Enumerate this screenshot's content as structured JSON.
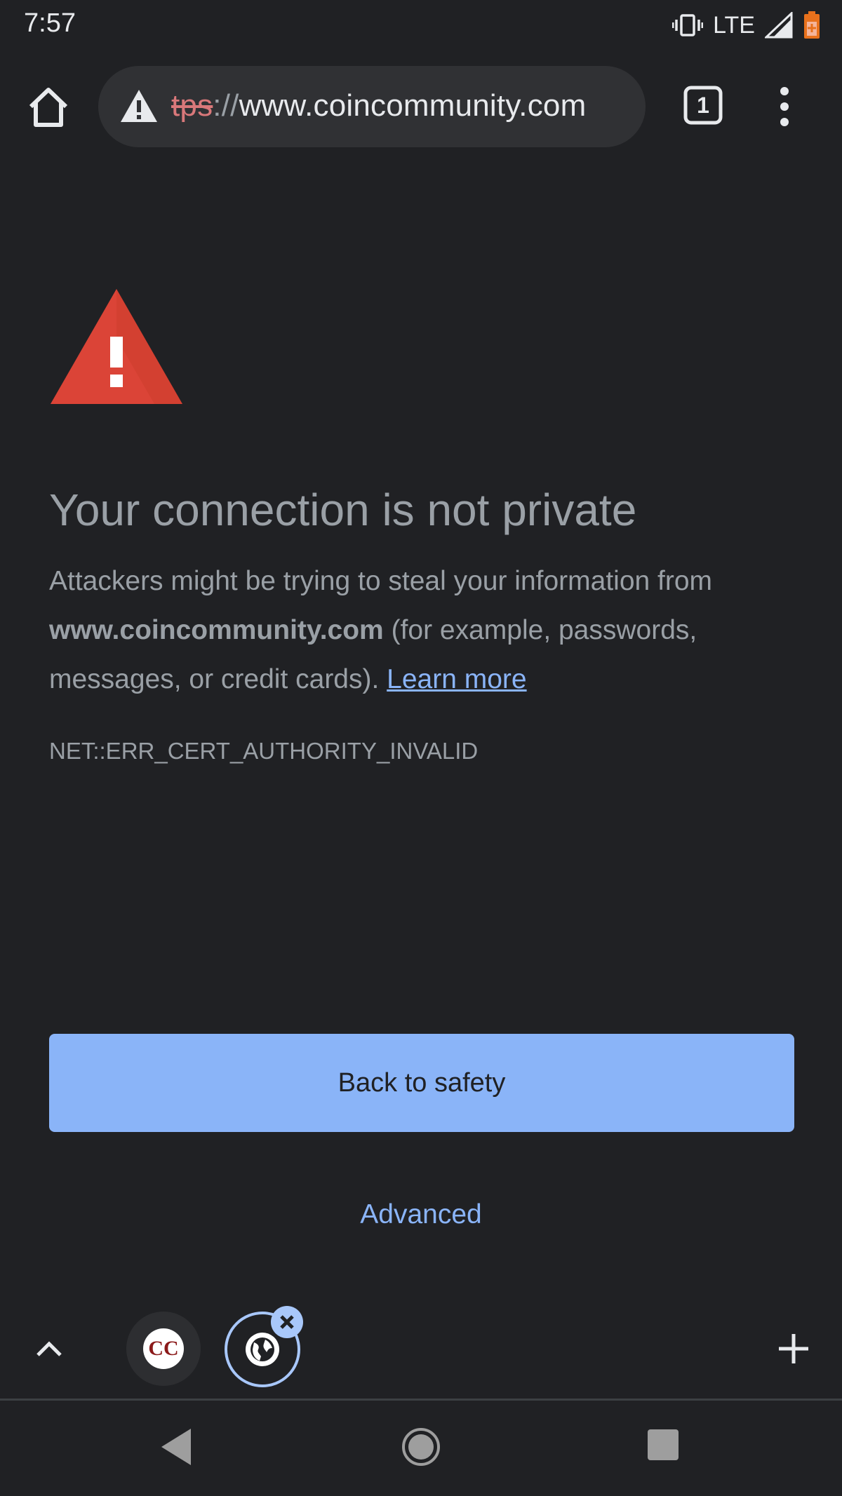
{
  "status_bar": {
    "time": "7:57",
    "network": "LTE"
  },
  "toolbar": {
    "url_scheme": "tps",
    "url_separator": "://",
    "url_host": "www.coincommunity.com",
    "tab_count": "1",
    "icons": [
      "home-icon",
      "not-secure-warning-icon",
      "tab-switcher-icon",
      "overflow-menu-icon"
    ]
  },
  "interstitial": {
    "headline": "Your connection is not private",
    "body_prefix": "Attackers might be trying to steal your information from",
    "body_domain": "www.coincommunity.com",
    "body_suffix": "(for example, passwords, messages, or credit cards).",
    "learn_more": "Learn more",
    "error_code": "NET::ERR_CERT_AUTHORITY_INVALID",
    "primary_button": "Back to safety",
    "secondary_button": "Advanced"
  },
  "tab_strip": {
    "tabs": [
      {
        "favicon_text": "CC",
        "active": false
      },
      {
        "favicon": "globe-icon",
        "active": true
      }
    ]
  },
  "colors": {
    "background": "#202124",
    "accent": "#8ab4f8",
    "warning_red": "#db4437",
    "text": "#9aa0a6"
  }
}
